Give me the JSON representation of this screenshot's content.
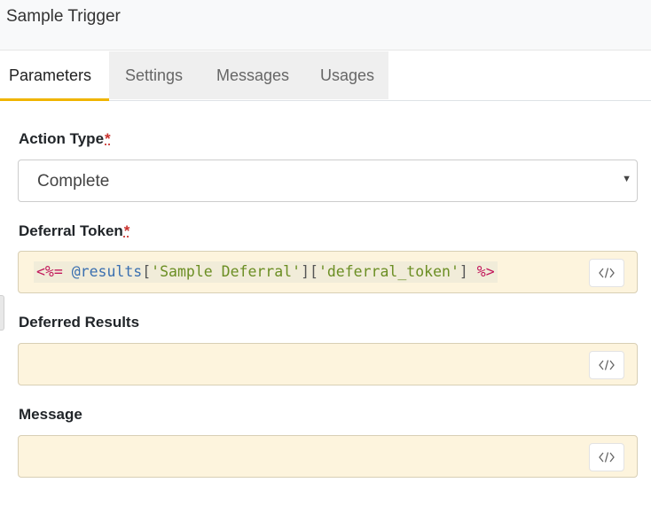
{
  "header": {
    "title": "Sample Trigger"
  },
  "tabs": [
    {
      "label": "Parameters",
      "active": true
    },
    {
      "label": "Settings",
      "active": false
    },
    {
      "label": "Messages",
      "active": false
    },
    {
      "label": "Usages",
      "active": false
    }
  ],
  "form": {
    "action_type": {
      "label": "Action Type",
      "required_mark": "*",
      "value": "Complete"
    },
    "deferral_token": {
      "label": "Deferral Token",
      "required_mark": "*",
      "code": {
        "open": "<%=",
        "ivar": "@results",
        "b1o": "[",
        "s1": "'Sample Deferral'",
        "b1c": "]",
        "b2o": "[",
        "s2": "'deferral_token'",
        "b2c": "]",
        "close": "%>"
      }
    },
    "deferred_results": {
      "label": "Deferred Results",
      "value": ""
    },
    "message": {
      "label": "Message",
      "value": ""
    }
  },
  "icons": {
    "code_toggle": "code-brackets-icon"
  },
  "colors": {
    "active_tab_accent": "#f0b400",
    "code_field_bg": "#fdf4dd",
    "required": "#c9302c"
  }
}
